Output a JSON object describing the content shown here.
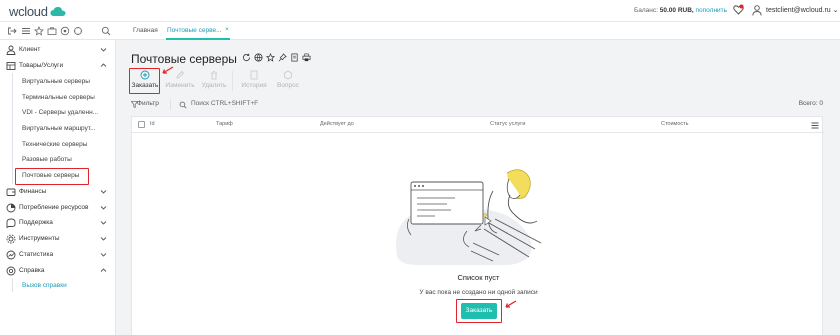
{
  "header": {
    "logo_text": "wcloud",
    "balance_label": "Баланс:",
    "balance_value": "50.00 RUB,",
    "topup_link": "пополнить",
    "user_email": "testclient@wcloud.ru"
  },
  "tabs": [
    {
      "label": "Главная"
    },
    {
      "label": "Почтовые серве..."
    }
  ],
  "sidebar": {
    "sections": [
      {
        "label": "Клиент",
        "icon": "user-icon"
      },
      {
        "label": "Товары/Услуги",
        "icon": "box-icon"
      },
      {
        "label": "Финансы",
        "icon": "wallet-icon"
      },
      {
        "label": "Потребление ресурсов",
        "icon": "pie-chart-icon"
      },
      {
        "label": "Поддержка",
        "icon": "support-icon"
      },
      {
        "label": "Инструменты",
        "icon": "gear-icon"
      },
      {
        "label": "Статистика",
        "icon": "stats-icon"
      },
      {
        "label": "Справка",
        "icon": "help-icon"
      }
    ],
    "services": [
      {
        "label": "Виртуальные серверы"
      },
      {
        "label": "Терминальные серверы"
      },
      {
        "label": "VDI - Серверы удаленн..."
      },
      {
        "label": "Виртуальные маршрут..."
      },
      {
        "label": "Технические серверы"
      },
      {
        "label": "Разовые работы"
      },
      {
        "label": "Почтовые серверы"
      }
    ],
    "help_link": "Вызов справки"
  },
  "page": {
    "title": "Почтовые серверы",
    "toolbar": [
      {
        "label": "Заказать",
        "enabled": true
      },
      {
        "label": "Изменить",
        "enabled": false
      },
      {
        "label": "Удалить",
        "enabled": false
      },
      {
        "label": "История",
        "enabled": false
      },
      {
        "label": "Вопрос",
        "enabled": false
      }
    ],
    "filter_label": "Фильтр",
    "search_placeholder": "Поиск CTRL+SHIFT+F",
    "total_label": "Всего: 0",
    "columns": [
      "Id",
      "Тариф",
      "Действует до",
      "Статус услуги",
      "Стоимость"
    ],
    "empty_title": "Список пуст",
    "empty_description": "У вас пока не создано ни одной записи",
    "order_button": "Заказать"
  },
  "colors": {
    "accent": "#1fbfb0",
    "link": "#1a9bb8",
    "highlight": "#e0242a"
  }
}
